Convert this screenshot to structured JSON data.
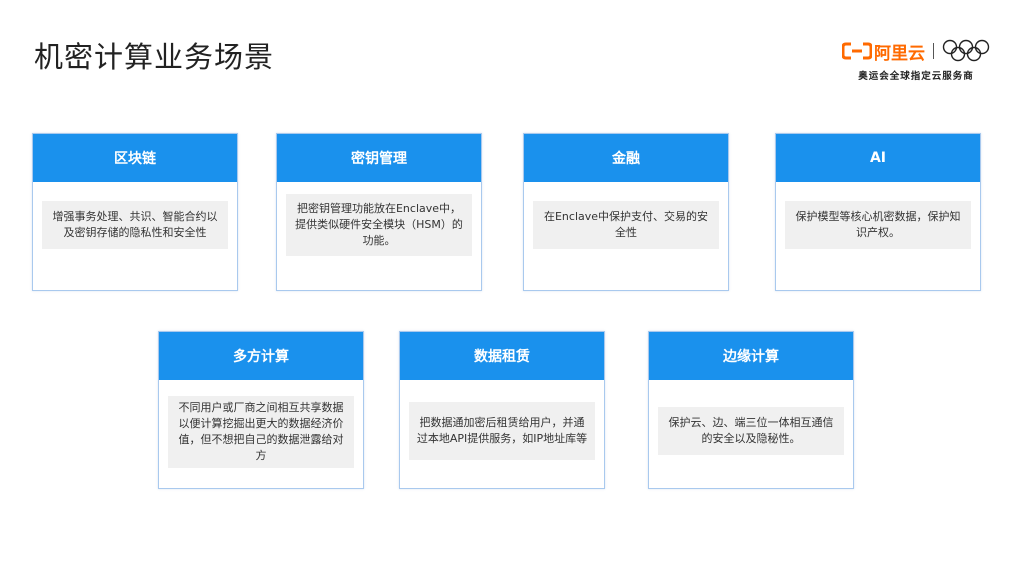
{
  "page": {
    "title": "机密计算业务场景"
  },
  "logo": {
    "brand_text": "阿里云",
    "subtitle": "奥运会全球指定云服务商",
    "brand_color": "#ff6a00"
  },
  "colors": {
    "card_header": "#1a91ed",
    "card_border": "#a9c9ee",
    "card_body_bg": "#f0f0f0"
  },
  "cards": [
    {
      "title": "区块链",
      "body": "增强事务处理、共识、智能合约以及密钥存储的隐私性和安全性"
    },
    {
      "title": "密钥管理",
      "body": "把密钥管理功能放在Enclave中，提供类似硬件安全模块（HSM）的功能。"
    },
    {
      "title": "金融",
      "body": "在Enclave中保护支付、交易的安全性"
    },
    {
      "title": "AI",
      "body": "保护模型等核心机密数据，保护知识产权。"
    },
    {
      "title": "多方计算",
      "body": "不同用户或厂商之间相互共享数据以便计算挖掘出更大的数据经济价值，但不想把自己的数据泄露给对方"
    },
    {
      "title": "数据租赁",
      "body": "把数据通加密后租赁给用户，并通过本地API提供服务，如IP地址库等"
    },
    {
      "title": "边缘计算",
      "body": "保护云、边、端三位一体相互通信的安全以及隐秘性。"
    }
  ]
}
